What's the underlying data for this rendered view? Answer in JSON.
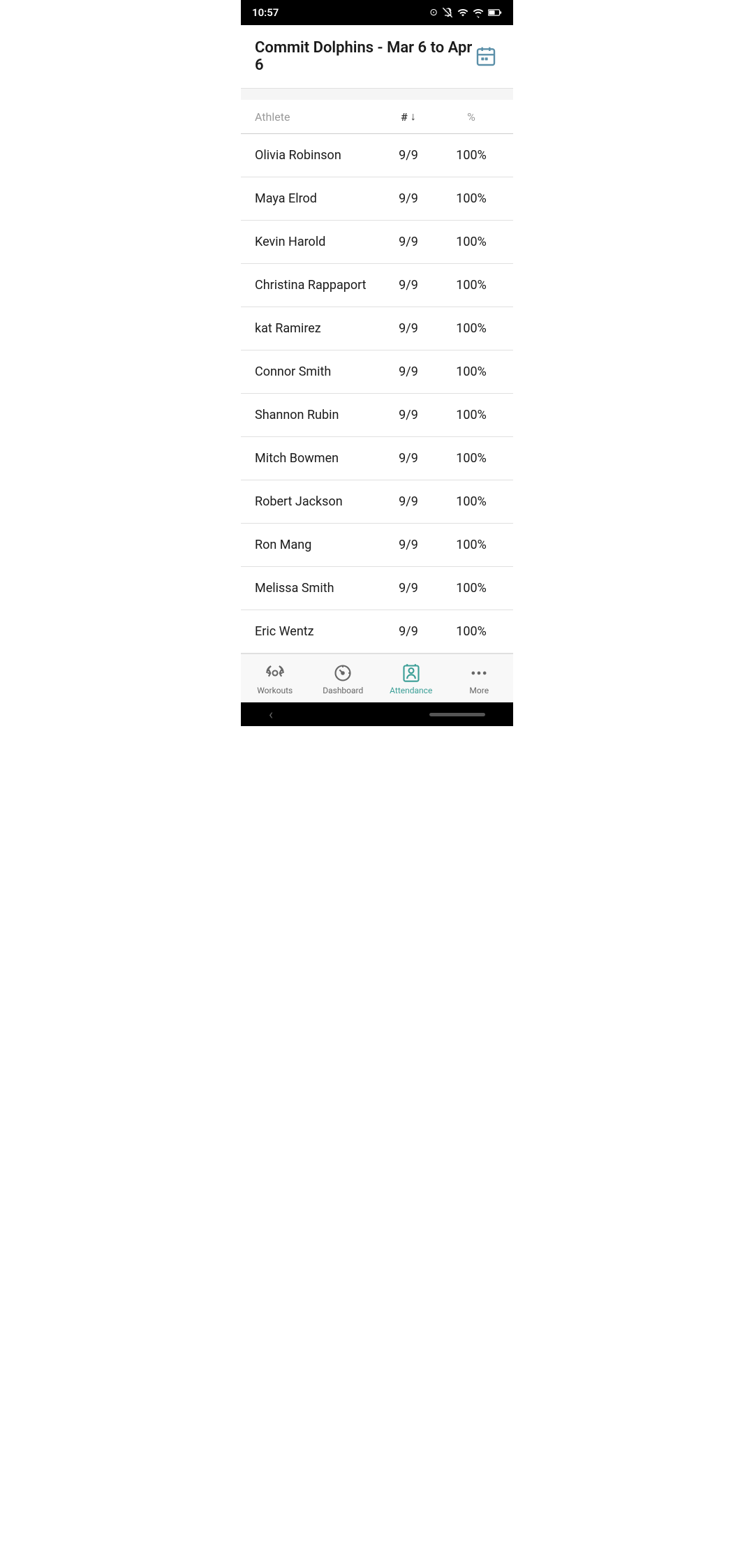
{
  "statusBar": {
    "time": "10:57",
    "icons": [
      "notification-off",
      "wifi",
      "signal",
      "battery"
    ]
  },
  "header": {
    "title": "Commit Dolphins - Mar 6 to Apr 6",
    "calendarIcon": "calendar"
  },
  "tableHeader": {
    "athleteLabel": "Athlete",
    "countLabel": "#",
    "percentLabel": "%"
  },
  "athletes": [
    {
      "name": "Olivia Robinson",
      "count": "9/9",
      "percent": "100%"
    },
    {
      "name": "Maya Elrod",
      "count": "9/9",
      "percent": "100%"
    },
    {
      "name": "Kevin Harold",
      "count": "9/9",
      "percent": "100%"
    },
    {
      "name": "Christina Rappaport",
      "count": "9/9",
      "percent": "100%"
    },
    {
      "name": "kat Ramirez",
      "count": "9/9",
      "percent": "100%"
    },
    {
      "name": "Connor Smith",
      "count": "9/9",
      "percent": "100%"
    },
    {
      "name": "Shannon Rubin",
      "count": "9/9",
      "percent": "100%"
    },
    {
      "name": "Mitch Bowmen",
      "count": "9/9",
      "percent": "100%"
    },
    {
      "name": "Robert Jackson",
      "count": "9/9",
      "percent": "100%"
    },
    {
      "name": "Ron Mang",
      "count": "9/9",
      "percent": "100%"
    },
    {
      "name": "Melissa Smith",
      "count": "9/9",
      "percent": "100%"
    },
    {
      "name": "Eric Wentz",
      "count": "9/9",
      "percent": "100%"
    }
  ],
  "bottomNav": {
    "items": [
      {
        "id": "workouts",
        "label": "Workouts",
        "active": false
      },
      {
        "id": "dashboard",
        "label": "Dashboard",
        "active": false
      },
      {
        "id": "attendance",
        "label": "Attendance",
        "active": true
      },
      {
        "id": "more",
        "label": "More",
        "active": false
      }
    ]
  }
}
